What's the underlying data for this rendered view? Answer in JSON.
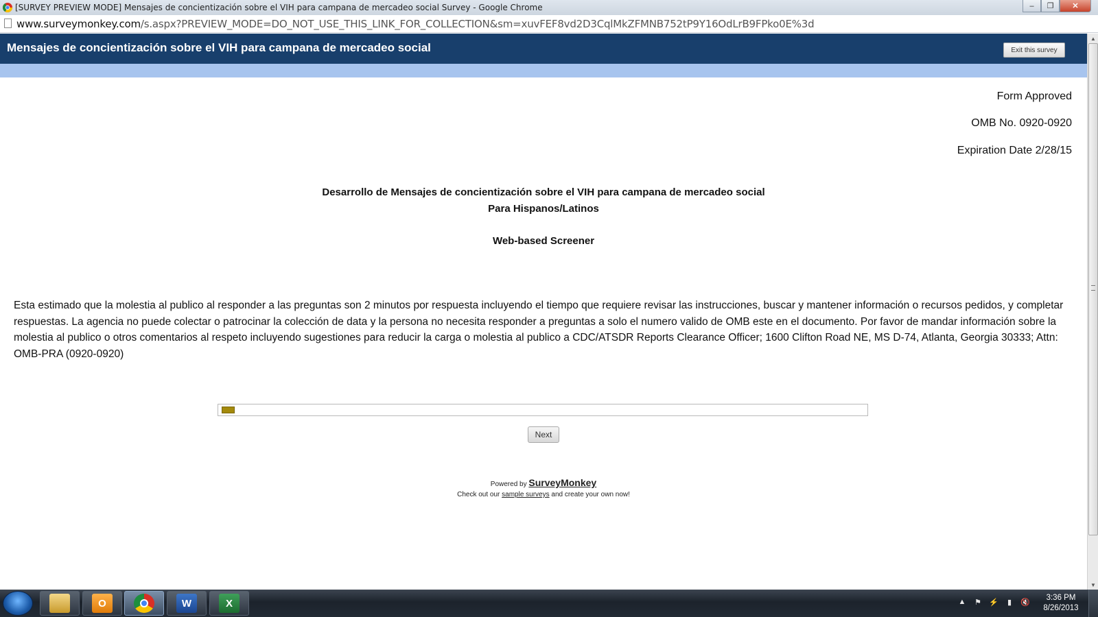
{
  "browser": {
    "window_title": "[SURVEY PREVIEW MODE] Mensajes de concientización sobre el VIH para campana de mercadeo social Survey - Google Chrome",
    "url_host": "www.surveymonkey.com",
    "url_path": "/s.aspx?PREVIEW_MODE=DO_NOT_USE_THIS_LINK_FOR_COLLECTION&sm=xuvFEF8vd2D3CqlMkZFMNB752tP9Y16OdLrB9FPko0E%3d"
  },
  "survey": {
    "header_title": "Mensajes de concientización sobre el VIH para campana de mercadeo social",
    "exit_label": "Exit this survey",
    "form_approved": "Form Approved",
    "omb_no": "OMB No. 0920-0920",
    "expiration": "Expiration Date 2/28/15",
    "heading_line1": "Desarrollo de Mensajes de concientización sobre el VIH para campana de mercadeo social",
    "heading_line2": "Para Hispanos/Latinos",
    "heading_line3": "Web-based Screener",
    "burden_statement": "Esta estimado que la molestia al publico al responder a las preguntas son 2 minutos por respuesta incluyendo el tiempo que requiere revisar las instrucciones, buscar y mantener información o recursos pedidos, y completar respuestas. La agencia no puede colectar o patrocinar la colección de data y la persona no necesita responder a preguntas a solo el numero valido de OMB este en el documento. Por favor de mandar información sobre la molestia al publico o otros comentarios al respeto incluyendo sugestiones para reducir la carga o molestia al publico a CDC/ATSDR Reports Clearance Officer; 1600 Clifton Road NE, MS D-74, Atlanta, Georgia 30333; Attn: OMB-PRA (0920-0920)",
    "progress_fraction": 0.02,
    "next_label": "Next",
    "powered_by": "Powered by",
    "brand": "SurveyMonkey",
    "checkout_prefix": "Check out our",
    "checkout_link": "sample surveys",
    "checkout_suffix": "and create your own now!"
  },
  "taskbar": {
    "apps": [
      "windows-explorer-icon",
      "outlook-icon",
      "chrome-icon",
      "word-icon",
      "excel-icon"
    ],
    "time": "3:36 PM",
    "date": "8/26/2013"
  },
  "colors": {
    "header_bg": "#183f6c",
    "subheader_bg": "#a7c4ee",
    "progress_fill": "#a48a0c"
  }
}
